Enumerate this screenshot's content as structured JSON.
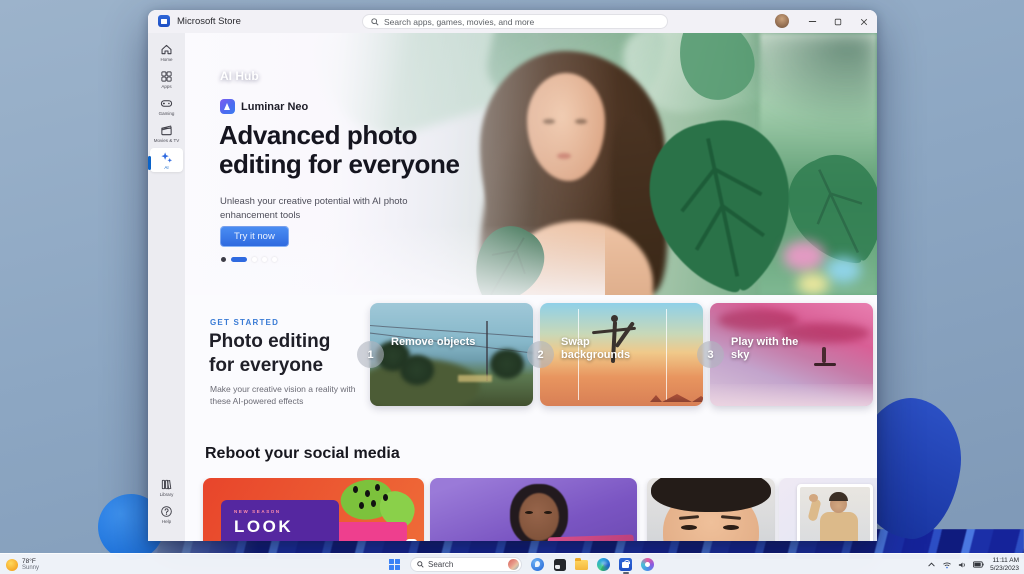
{
  "taskbar": {
    "weather": {
      "temp": "78°F",
      "condition": "Sunny"
    },
    "search_label": "Search",
    "clock": {
      "time": "11:11 AM",
      "date": "5/23/2023"
    }
  },
  "titlebar": {
    "app_title": "Microsoft Store",
    "search_placeholder": "Search apps, games, movies, and more"
  },
  "sidebar": {
    "items": [
      {
        "label": "Home"
      },
      {
        "label": "Apps"
      },
      {
        "label": "Gaming"
      },
      {
        "label": "Movies & TV"
      },
      {
        "label": "AI"
      }
    ],
    "bottom_items": [
      {
        "label": "Library"
      },
      {
        "label": "Help"
      }
    ]
  },
  "hero": {
    "section_label": "AI Hub",
    "app_name": "Luminar Neo",
    "title_line1": "Advanced photo",
    "title_line2": "editing for everyone",
    "subtitle": "Unleash your creative potential with AI photo enhancement tools",
    "cta_label": "Try it now"
  },
  "get_started": {
    "eyebrow": "GET STARTED",
    "title_line1": "Photo editing",
    "title_line2": "for everyone",
    "subtitle": "Make your creative vision a reality with these AI-powered effects",
    "cards": [
      {
        "number": "1",
        "label": "Remove objects"
      },
      {
        "number": "2",
        "label": "Swap backgrounds"
      },
      {
        "number": "3",
        "label": "Play with the sky"
      }
    ]
  },
  "social": {
    "heading": "Reboot your social media",
    "promo_card": {
      "eyebrow": "NEW SEASON",
      "title": "LOOK"
    }
  },
  "colors": {
    "accent": "#0a63c9",
    "cta_blue": "#2f6ae0",
    "eyebrow_blue": "#3a7bd5",
    "taskbar_bg": "#f2f5fa",
    "store_icon_blue": "#2457c5"
  }
}
